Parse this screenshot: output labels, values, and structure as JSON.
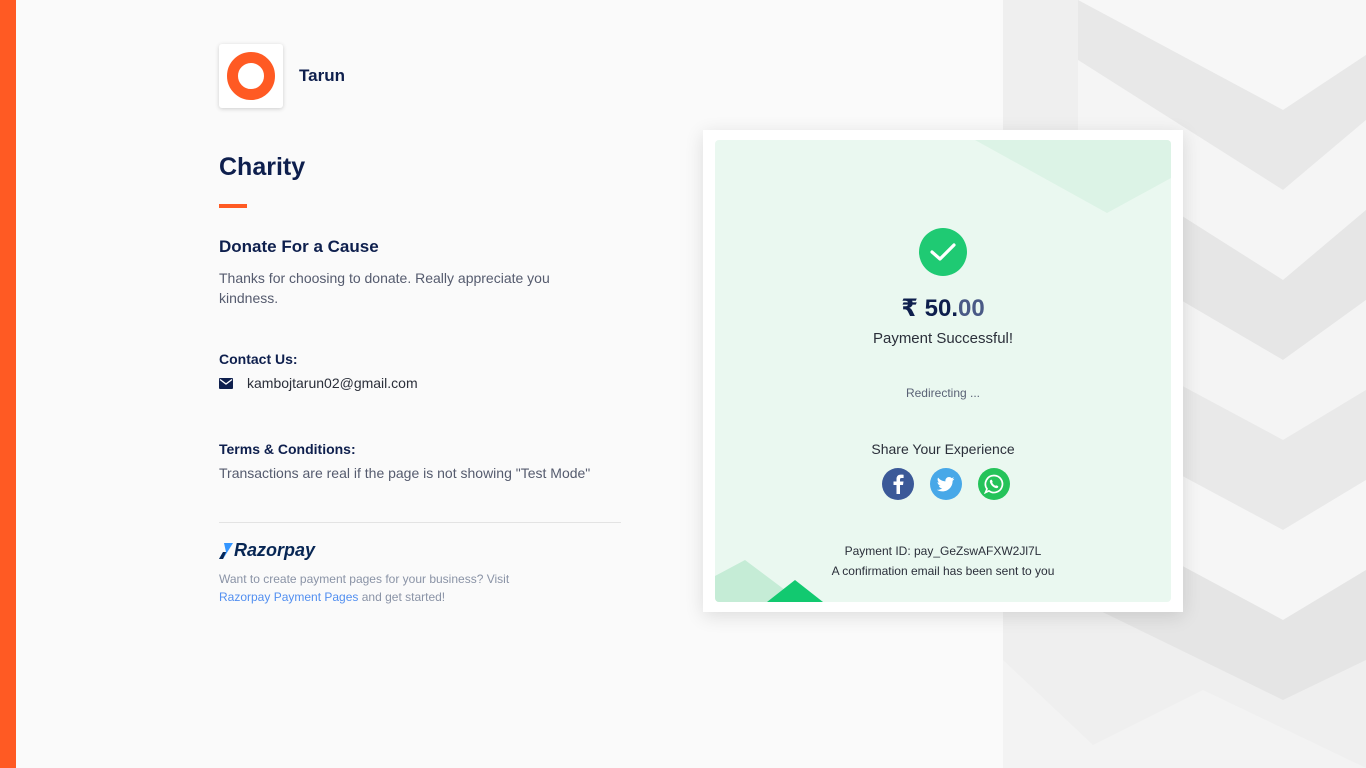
{
  "merchant": {
    "name": "Tarun",
    "brand_color": "#ff5a23"
  },
  "page": {
    "title": "Charity",
    "cause_title": "Donate For a Cause",
    "cause_description": "Thanks for choosing to donate. Really appreciate you kindness."
  },
  "contact": {
    "heading": "Contact Us:",
    "email": "kambojtarun02@gmail.com",
    "icon": "mail-icon"
  },
  "terms": {
    "heading": "Terms & Conditions:",
    "text": "Transactions are real if the page is not showing \"Test Mode\""
  },
  "footer": {
    "brand": "Razorpay",
    "promo_prefix": "Want to create payment pages for your business? Visit ",
    "promo_link": "Razorpay Payment Pages",
    "promo_suffix": " and get started!"
  },
  "payment": {
    "currency_symbol": "₹",
    "amount_whole": "50.",
    "amount_decimal": "00",
    "status": "Payment Successful!",
    "redirect": "Redirecting ...",
    "share_heading": "Share Your Experience",
    "share_icons": [
      "facebook-icon",
      "twitter-icon",
      "whatsapp-icon"
    ],
    "payment_id": "Payment ID: pay_GeZswAFXW2Jl7L",
    "confirmation": "A confirmation email has been sent to you",
    "success_color": "#1fca73"
  }
}
